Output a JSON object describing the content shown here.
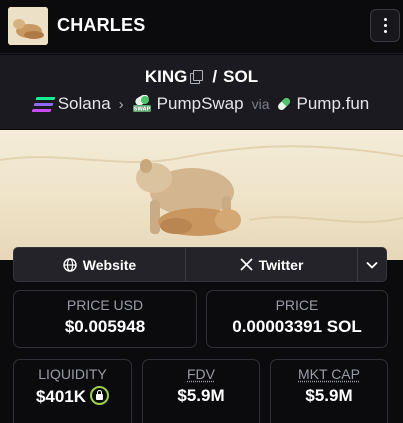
{
  "header": {
    "title": "CHARLES",
    "logo_icon": "dog-avatar-icon",
    "menu_icon": "vertical-dots-icon"
  },
  "pair": {
    "base": "KING",
    "separator": "/",
    "quote": "SOL"
  },
  "route": {
    "chain": "Solana",
    "dex": "PumpSwap",
    "via_label": "via",
    "launchpad": "Pump.fun"
  },
  "links": {
    "website_label": "Website",
    "twitter_label": "Twitter"
  },
  "stats": {
    "price_usd_label": "PRICE USD",
    "price_usd_value": "$0.005948",
    "price_label": "PRICE",
    "price_value": "0.00003391 SOL",
    "liquidity_label": "LIQUIDITY",
    "liquidity_value": "$401K",
    "fdv_label": "FDV",
    "fdv_value": "$5.9M",
    "mktcap_label": "MKT CAP",
    "mktcap_value": "$5.9M"
  },
  "colors": {
    "background": "#0b0b0e",
    "panel": "#1a1a20",
    "lock_ring": "#9fd04a",
    "solana_green": "#14f195",
    "solana_purple": "#8c6cf4"
  }
}
